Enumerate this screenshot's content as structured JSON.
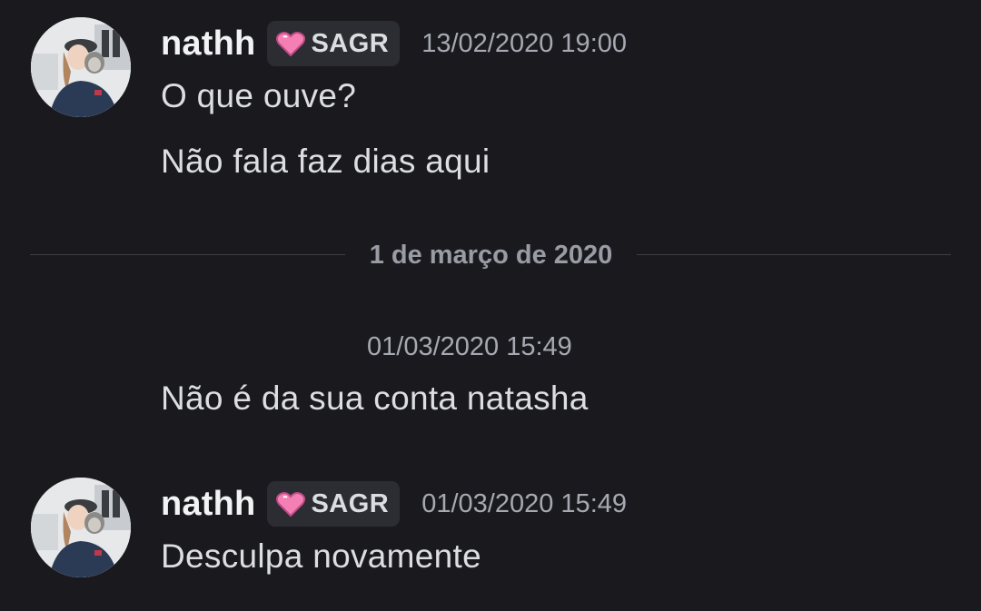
{
  "colors": {
    "background": "#1a1a1e",
    "username": "#f2f3f5",
    "message_text": "#dcdee2",
    "timestamp": "#a6a9b2",
    "tag_bg": "#2c2d33",
    "heart": "#f47fb5",
    "divider": "#3c3e45"
  },
  "messages": [
    {
      "author": "nathh",
      "tag": {
        "icon": "pink-heart-icon",
        "label": "SAGR"
      },
      "timestamp": "13/02/2020 19:00",
      "lines": [
        "O que ouve?",
        "Não fala faz dias aqui"
      ]
    },
    {
      "timestamp": "01/03/2020 15:49",
      "lines": [
        "Não é da sua conta natasha"
      ]
    },
    {
      "author": "nathh",
      "tag": {
        "icon": "pink-heart-icon",
        "label": "SAGR"
      },
      "timestamp": "01/03/2020 15:49",
      "lines": [
        "Desculpa novamente"
      ]
    }
  ],
  "date_divider": {
    "label": "1 de março de 2020"
  }
}
